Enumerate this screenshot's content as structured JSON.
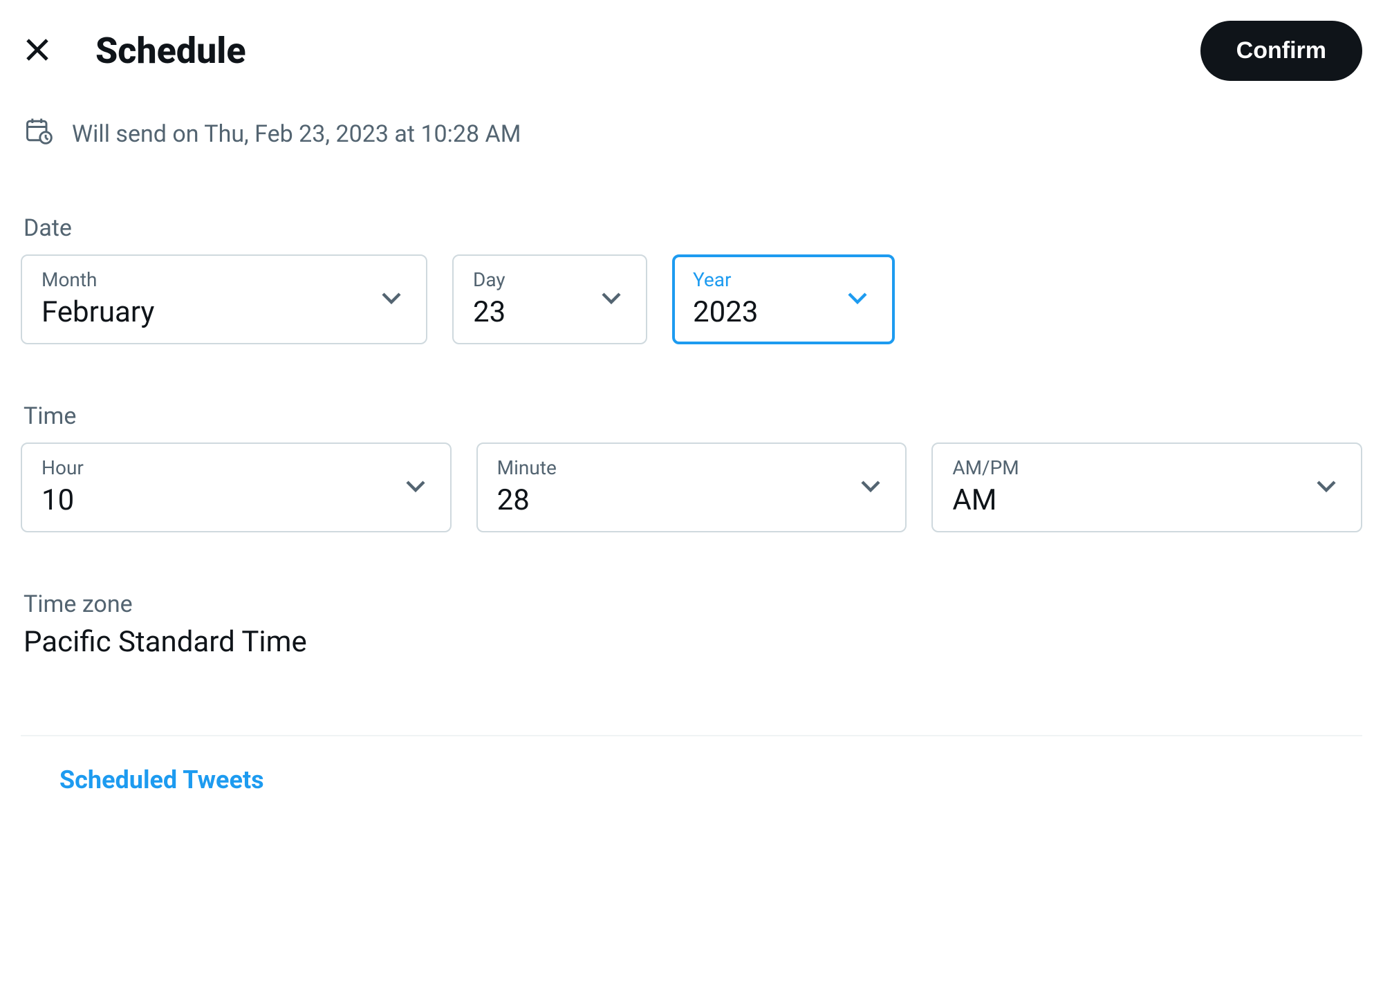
{
  "header": {
    "title": "Schedule",
    "confirm_label": "Confirm"
  },
  "summary": {
    "text": "Will send on Thu, Feb 23, 2023 at 10:28 AM"
  },
  "date": {
    "section_label": "Date",
    "month": {
      "label": "Month",
      "value": "February"
    },
    "day": {
      "label": "Day",
      "value": "23"
    },
    "year": {
      "label": "Year",
      "value": "2023"
    }
  },
  "time": {
    "section_label": "Time",
    "hour": {
      "label": "Hour",
      "value": "10"
    },
    "minute": {
      "label": "Minute",
      "value": "28"
    },
    "ampm": {
      "label": "AM/PM",
      "value": "AM"
    }
  },
  "timezone": {
    "label": "Time zone",
    "value": "Pacific Standard Time"
  },
  "footer": {
    "scheduled_link": "Scheduled Tweets"
  }
}
